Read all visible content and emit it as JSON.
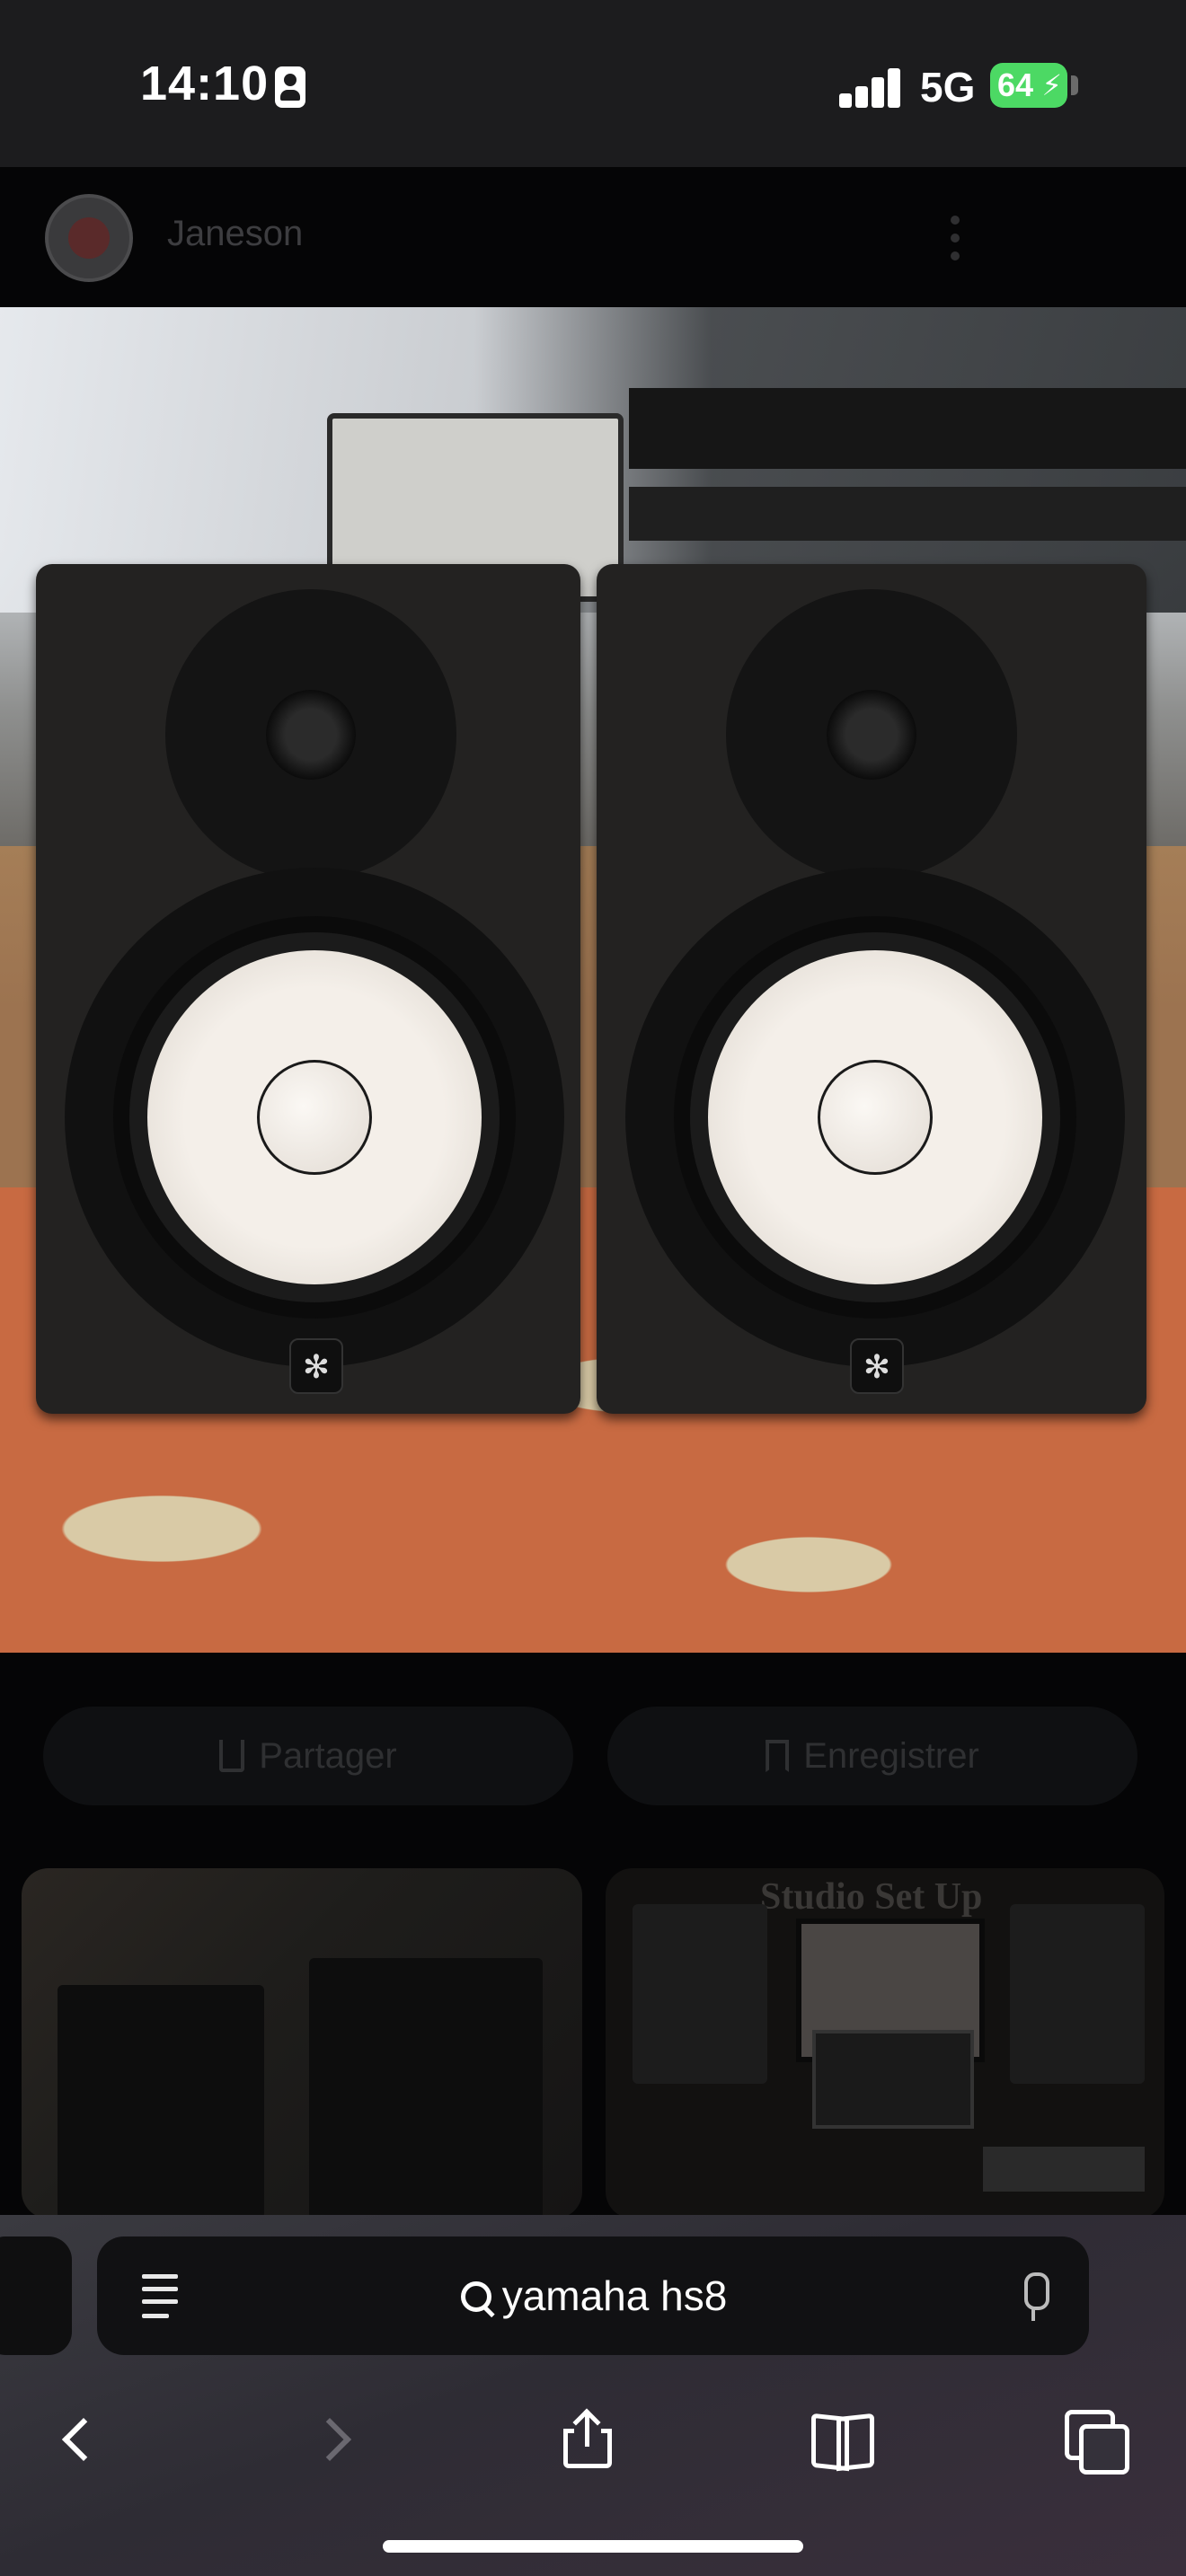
{
  "status_bar": {
    "time": "14:10",
    "network": "5G",
    "battery": "64"
  },
  "pin": {
    "author": "Janeson",
    "image_alt": "Yamaha HS8 studio monitors"
  },
  "actions": {
    "share_label": "Partager",
    "save_label": "Enregistrer"
  },
  "related": {
    "thumb2_title": "Studio Set Up"
  },
  "browser": {
    "search_query": "yamaha hs8"
  },
  "icons": {
    "status": [
      "person-focus-icon",
      "signal-icon",
      "battery-icon"
    ],
    "toolbar": [
      "back-icon",
      "forward-icon",
      "share-icon",
      "bookmarks-icon",
      "tabs-icon"
    ]
  }
}
